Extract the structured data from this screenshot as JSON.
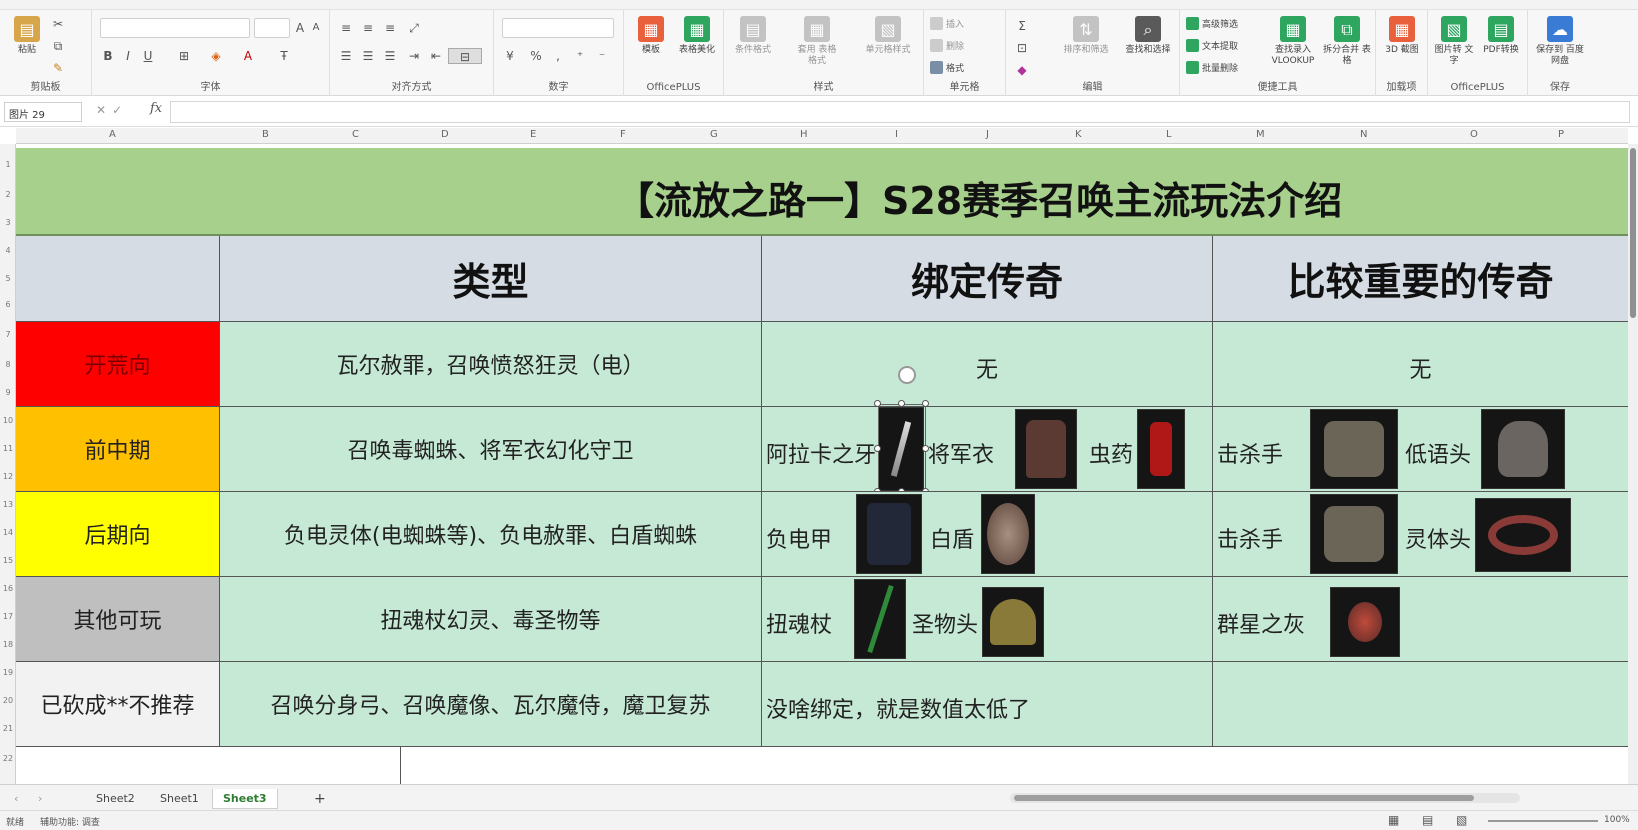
{
  "ribbon": {
    "groups": {
      "clipboard": "剪贴板",
      "font": "字体",
      "alignment": "对齐方式",
      "number": "数字",
      "officeplus_1": "OfficePLUS",
      "styles": "样式",
      "cells": "单元格",
      "editing": "编辑",
      "convenience": "便捷工具",
      "addins": "加载项",
      "officeplus_2": "OfficePLUS",
      "save": "保存"
    },
    "buttons": {
      "paste": "粘贴",
      "template": "模板",
      "table_beautify": "表格美化",
      "conditional_format": "条件格式",
      "table_format": "套用\n表格格式",
      "cell_style": "单元格样式",
      "insert": "插入",
      "delete": "删除",
      "format": "格式",
      "sort_filter": "排序和筛选",
      "find_select": "查找和选择",
      "advanced_filter": "高级筛选",
      "text_extract": "文本提取",
      "batch_delete": "批量删除",
      "find_vlookup": "查找录入\nVLOOKUP",
      "split_merge": "拆分合并\n表格",
      "addin_3d": "3D\n截图",
      "image_to_text": "图片转\n文字",
      "pdf_convert": "PDF转换",
      "save_to_cloud": "保存到\n百度网盘"
    }
  },
  "formula_bar": {
    "name_box": "图片 29",
    "fx": "fx",
    "value": ""
  },
  "columns": [
    "A",
    "B",
    "C",
    "D",
    "E",
    "F",
    "G",
    "H",
    "I",
    "J",
    "K",
    "L",
    "M",
    "N",
    "O",
    "P"
  ],
  "rows": [
    "1",
    "2",
    "3",
    "4",
    "5",
    "6",
    "7",
    "8",
    "9",
    "10",
    "11",
    "12",
    "13",
    "14",
    "15",
    "16",
    "17",
    "18",
    "19",
    "20",
    "21",
    "22"
  ],
  "sheet": {
    "title": "【流放之路一】S28赛季召唤主流玩法介绍",
    "headers": {
      "category": "",
      "type": "类型",
      "bound_legendary": "绑定传奇",
      "important_legendary": "比较重要的传奇"
    },
    "rows": [
      {
        "category": "开荒向",
        "category_bg": "#ff0000",
        "type": "瓦尔赦罪，召唤愤怒狂灵（电）",
        "bound_text": "无",
        "important_text": "无"
      },
      {
        "category": "前中期",
        "category_bg": "#ffc000",
        "type": "召唤毒蜘蛛、将军衣幻化守卫",
        "bound_items": [
          "阿拉卡之牙",
          "将军衣",
          "虫药"
        ],
        "important_items": [
          "击杀手",
          "低语头"
        ]
      },
      {
        "category": "后期向",
        "category_bg": "#ffff00",
        "type": "负电灵体(电蜘蛛等)、负电赦罪、白盾蜘蛛",
        "bound_items": [
          "负电甲",
          "白盾"
        ],
        "important_items": [
          "击杀手",
          "灵体头"
        ]
      },
      {
        "category": "其他可玩",
        "category_bg": "#bfbfbf",
        "type": "扭魂杖幻灵、毒圣物等",
        "bound_items": [
          "扭魂杖",
          "圣物头"
        ],
        "important_items": [
          "群星之灰"
        ]
      },
      {
        "category": "已砍成**不推荐",
        "category_bg": "#f2f2f2",
        "type": "召唤分身弓、召唤魔像、瓦尔魔侍，魔卫复苏",
        "bound_text": "没啥绑定，就是数值太低了",
        "important_text": ""
      }
    ]
  },
  "tabs": [
    "Sheet2",
    "Sheet1",
    "Sheet3"
  ],
  "active_tab": "Sheet3",
  "add_sheet": "+",
  "status": {
    "left": "就绪",
    "accessibility": "辅助功能: 调查",
    "zoom": "100%"
  }
}
